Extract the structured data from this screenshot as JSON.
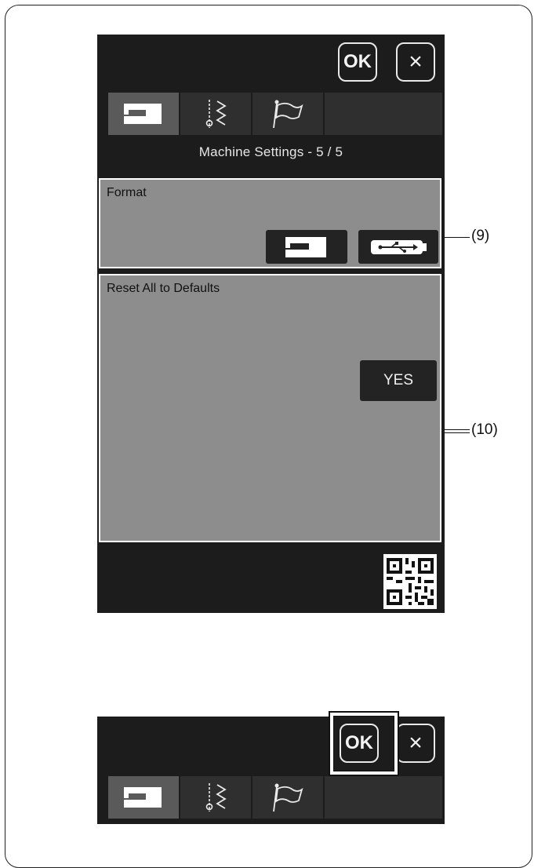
{
  "screen1": {
    "ok_label": "OK",
    "close_label": "×",
    "title": "Machine Settings  -  5 / 5",
    "format": {
      "label": "Format"
    },
    "reset": {
      "label": "Reset All to Defaults",
      "yes_label": "YES"
    },
    "tabs": [
      "sewing-machine-icon",
      "stitch-icon",
      "flag-icon"
    ]
  },
  "screen2": {
    "ok_label": "OK",
    "close_label": "×"
  },
  "callouts": {
    "format": "(9)",
    "reset": "(10)"
  },
  "colors": {
    "screen_bg": "#1c1c1c",
    "panel_bg": "#8d8d8d",
    "active_tab": "#5a5a5a",
    "tab_bg": "#2f2f2f"
  }
}
